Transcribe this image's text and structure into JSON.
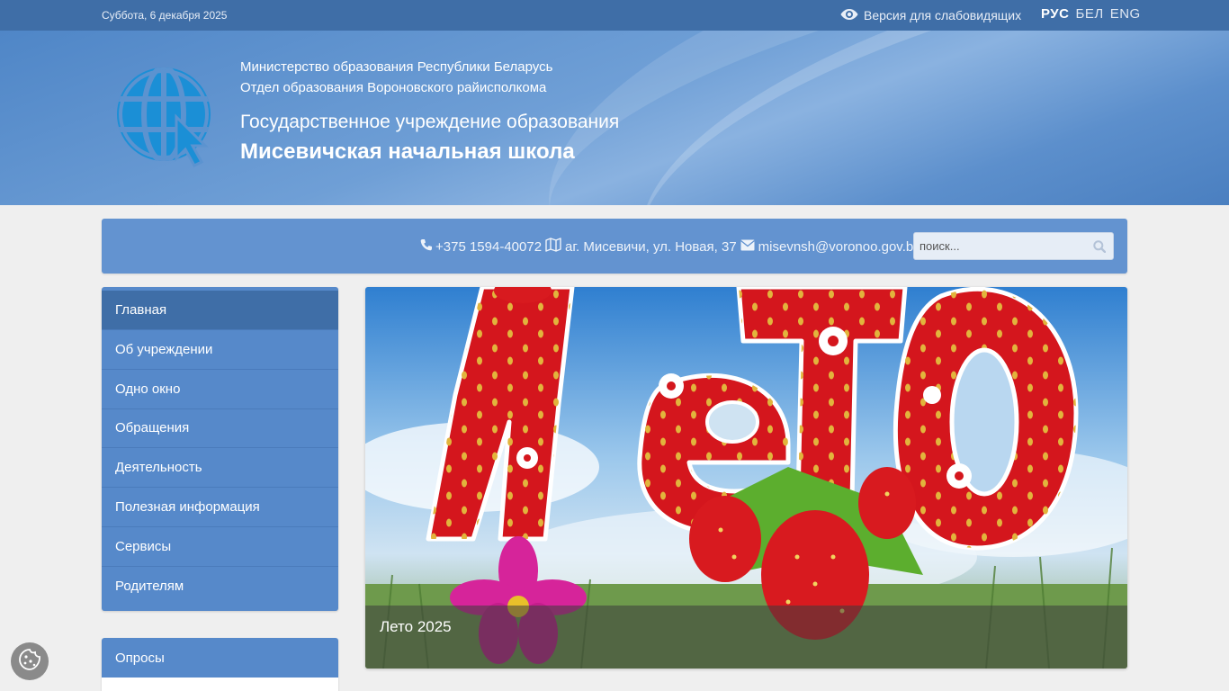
{
  "topbar": {
    "date": "Суббота, 6 декабря 2025",
    "vision_label": "Версия для слабовидящих",
    "languages": [
      "РУС",
      "БЕЛ",
      "ENG"
    ],
    "active_language": "РУС"
  },
  "header": {
    "ministry": "Министерство образования Республики Беларусь",
    "department": "Отдел образования Вороновского райисполкома",
    "institution_type": "Государственное учреждение образования",
    "school_name": "Мисевичская начальная школа"
  },
  "contacts": {
    "phone": "+375 1594-40072",
    "address": "аг. Мисевичи, ул. Новая, 37",
    "email": "misevnsh@voronoo.gov.by"
  },
  "search": {
    "placeholder": "поиск..."
  },
  "menu": {
    "items": [
      {
        "label": "Главная"
      },
      {
        "label": "Об учреждении"
      },
      {
        "label": "Одно окно"
      },
      {
        "label": "Обращения"
      },
      {
        "label": "Деятельность"
      },
      {
        "label": "Полезная информация"
      },
      {
        "label": "Сервисы"
      },
      {
        "label": "Родителям"
      }
    ]
  },
  "polls": {
    "title": "Опросы"
  },
  "banner": {
    "caption": "Лето 2025",
    "image_text": "Лето"
  },
  "colors": {
    "topbar": "#3f6ea7",
    "accent": "#5689ca",
    "active_menu": "#3f6ea7",
    "banner_red": "#d4161d"
  },
  "icons": [
    "eye-icon",
    "globe-cursor-logo",
    "phone-icon",
    "map-icon",
    "envelope-icon",
    "search-icon",
    "cookie-icon"
  ]
}
